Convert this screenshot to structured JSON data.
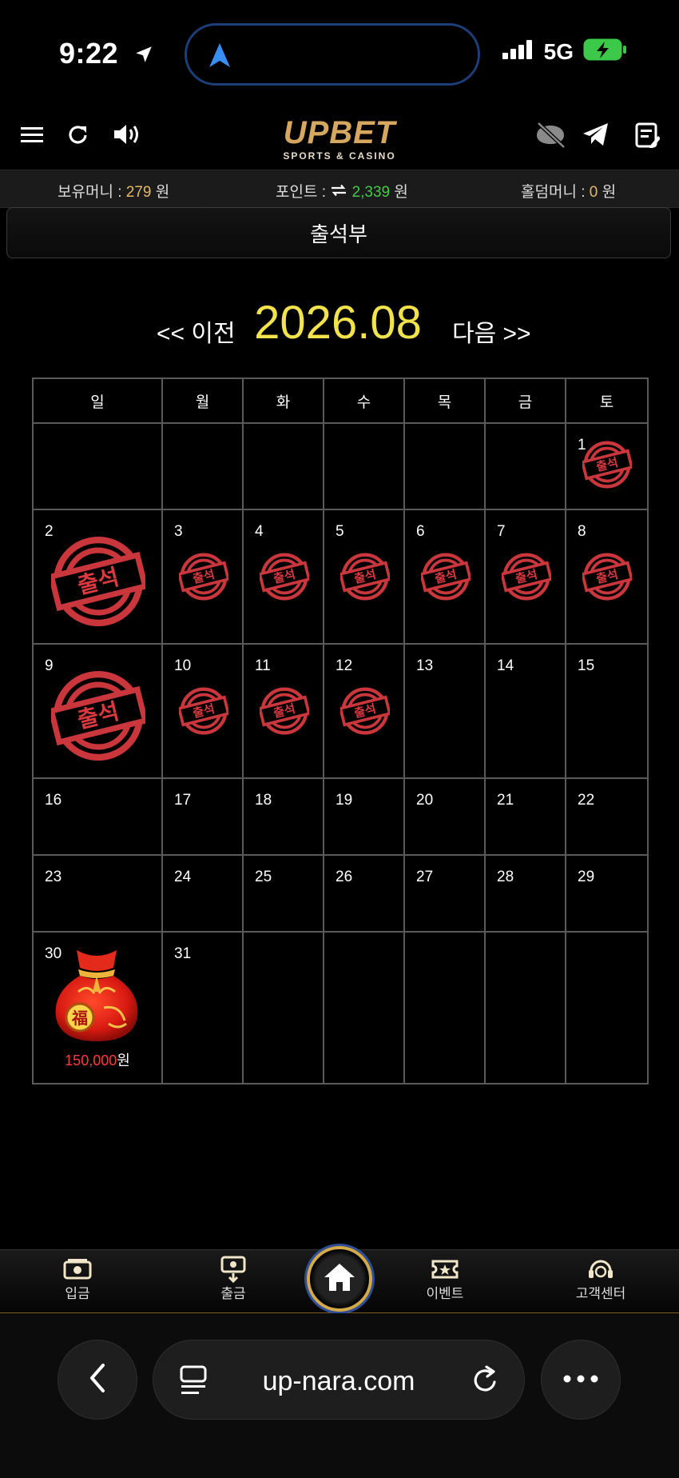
{
  "status": {
    "time": "9:22",
    "network": "5G",
    "battery": "charging"
  },
  "app": {
    "brand": "UPBET",
    "brand_sub": "SPORTS & CASINO",
    "left_icons": [
      "menu-icon",
      "refresh-icon",
      "speaker-icon"
    ],
    "right_icons": [
      "no-chat-icon",
      "telegram-icon",
      "notes-icon"
    ]
  },
  "money": {
    "balance_label": "보유머니 :",
    "balance_value": "279",
    "balance_unit": "원",
    "point_label": "포인트 :",
    "point_value": "2,339",
    "point_unit": "원",
    "holdem_label": "홀덤머니 :",
    "holdem_value": "0",
    "holdem_unit": "원"
  },
  "page_title": "출석부",
  "month_nav": {
    "prev": "<< 이전",
    "current": "2026.08",
    "next": "다음 >>"
  },
  "calendar": {
    "weekdays": [
      "일",
      "월",
      "화",
      "수",
      "목",
      "금",
      "토"
    ],
    "stamp_text": "출석",
    "weeks": [
      [
        "",
        "",
        "",
        "",
        "",
        "",
        "1"
      ],
      [
        "2",
        "3",
        "4",
        "5",
        "6",
        "7",
        "8"
      ],
      [
        "9",
        "10",
        "11",
        "12",
        "13",
        "14",
        "15"
      ],
      [
        "16",
        "17",
        "18",
        "19",
        "20",
        "21",
        "22"
      ],
      [
        "23",
        "24",
        "25",
        "26",
        "27",
        "28",
        "29"
      ],
      [
        "30",
        "31",
        "",
        "",
        "",
        "",
        ""
      ]
    ],
    "attended": [
      "1",
      "2",
      "3",
      "4",
      "5",
      "6",
      "7",
      "8",
      "9",
      "10",
      "11",
      "12"
    ],
    "prize_day": "30",
    "prize_amount": "150,000",
    "prize_unit": "원"
  },
  "bottom_nav": {
    "deposit": "입금",
    "withdraw": "출금",
    "event": "이벤트",
    "support": "고객센터"
  },
  "browser": {
    "url": "up-nara.com"
  }
}
